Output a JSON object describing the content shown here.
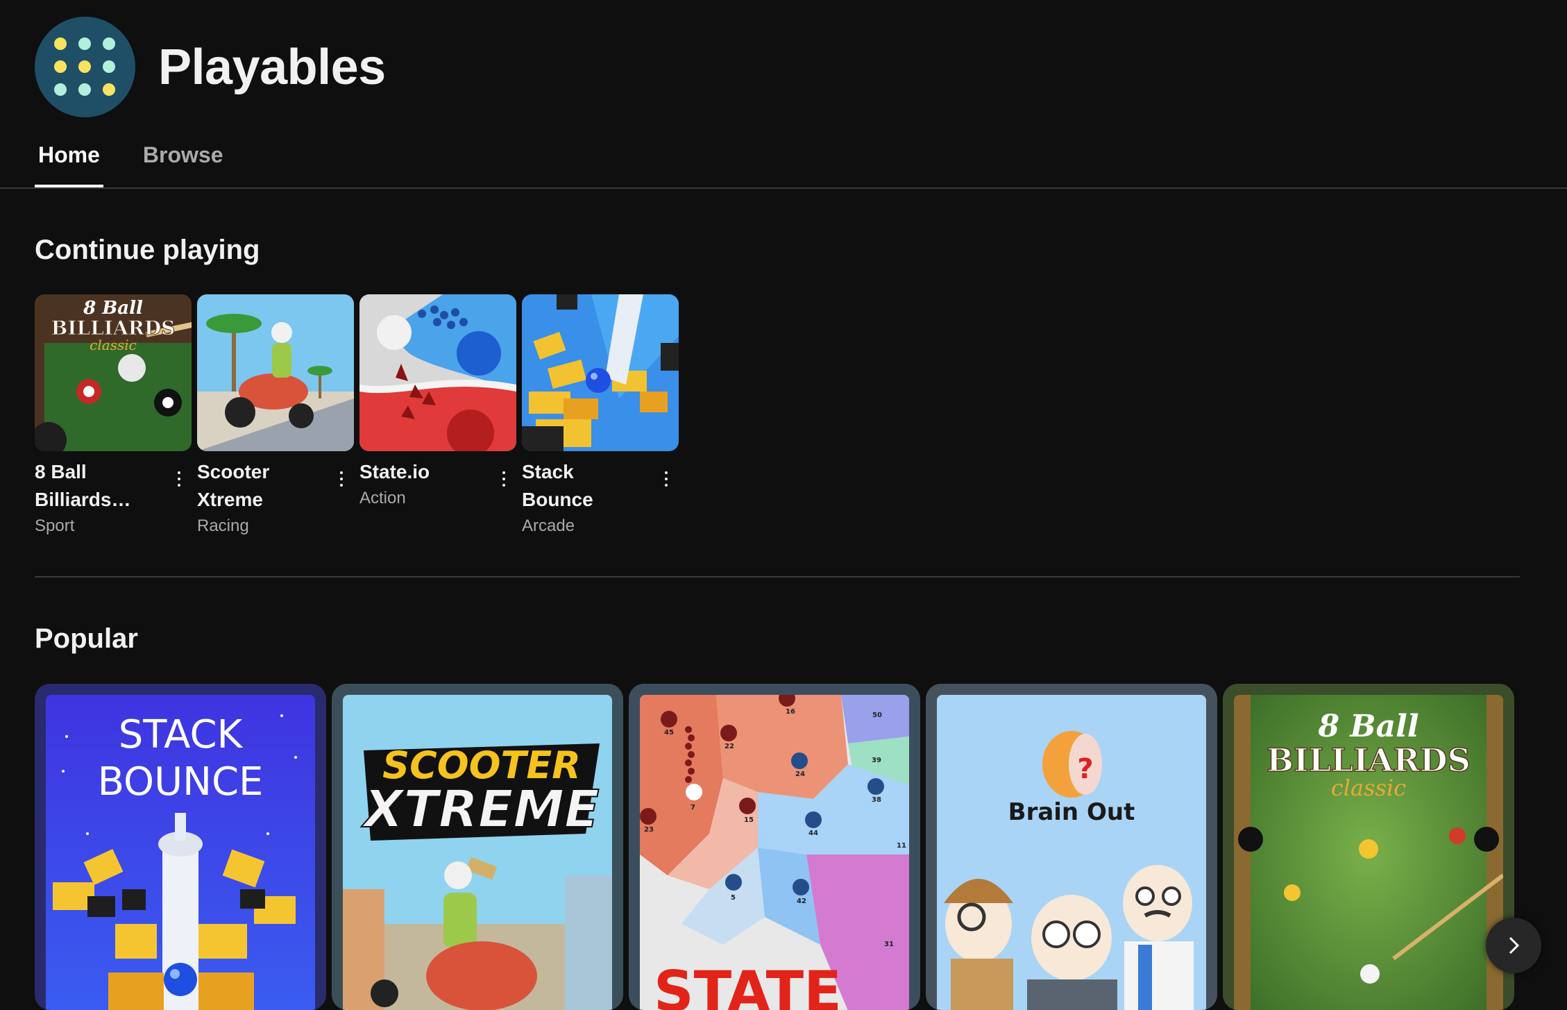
{
  "channel": {
    "title": "Playables",
    "logo_icon": "dice-dots-icon"
  },
  "tabs": [
    {
      "label": "Home",
      "active": true
    },
    {
      "label": "Browse",
      "active": false
    }
  ],
  "continue_playing": {
    "title": "Continue playing",
    "games": [
      {
        "name": "8 Ball Billiards…",
        "genre": "Sport",
        "thumb_text_1": "8 Ball",
        "thumb_text_2": "BILLIARDS",
        "thumb_text_3": "classic"
      },
      {
        "name": "Scooter Xtreme",
        "genre": "Racing"
      },
      {
        "name": "State.io",
        "genre": "Action"
      },
      {
        "name": "Stack Bounce",
        "genre": "Arcade"
      }
    ]
  },
  "popular": {
    "title": "Popular",
    "games": [
      {
        "art_text": "STACK BOUNCE"
      },
      {
        "art_text_1": "SCOOTER",
        "art_text_2": "XTREME"
      },
      {
        "art_text": "STATE",
        "map_labels": [
          "16",
          "50",
          "45",
          "22",
          "24",
          "39",
          "38",
          "44",
          "23",
          "15",
          "11",
          "7",
          "5",
          "42",
          "31"
        ]
      },
      {
        "art_text": "Brain Out"
      },
      {
        "art_text_1": "8 Ball",
        "art_text_2": "BILLIARDS",
        "art_text_3": "classic"
      }
    ]
  },
  "colors": {
    "background": "#0f0f0f",
    "text": "#f1f1f1",
    "muted": "#aaaaaa"
  }
}
